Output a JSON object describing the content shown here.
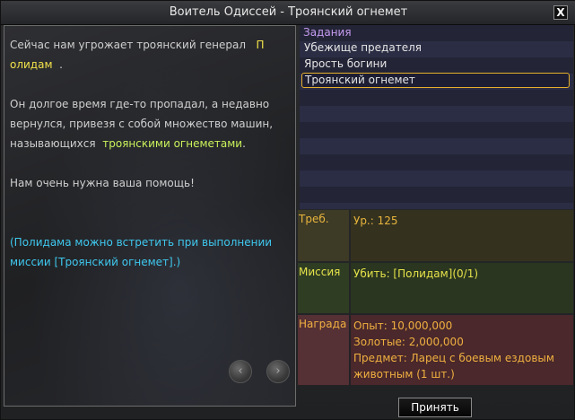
{
  "window": {
    "title": "Воитель Одиссей - Троянский огнемет",
    "close_label": "X"
  },
  "dialog": {
    "p1_text": "Сейчас нам угрожает троянский генерал",
    "p1_npc_a": "П",
    "p1_npc_b": "олидам",
    "p1_end": ".",
    "p2_a": "Он долгое время где-то пропадал, а недавно",
    "p2_b": "вернулся, привезя с собой множество машин,",
    "p2_c": "называющихся",
    "p2_highlight": "троянскими огнеметами",
    "p2_end": ".",
    "p3": "Нам очень нужна ваша помощь!",
    "hint_a": "(Полидама можно встретить при выполнении",
    "hint_b": "миссии [Троянский огнемет].)",
    "prev_glyph": "‹",
    "next_glyph": "›"
  },
  "quests": {
    "header": "Задания",
    "items": [
      {
        "label": "Убежище предателя"
      },
      {
        "label": "Ярость богини"
      },
      {
        "label": "Троянский огнемет"
      }
    ],
    "selected_index": 2
  },
  "info": {
    "req_label": "Треб.",
    "req_value": "Ур.: 125",
    "mission_label": "Миссия",
    "mission_value": "Убить: [Полидам](0/1)",
    "reward_label": "Награда",
    "reward_exp": "Опыт: 10,000,000",
    "reward_gold": "Золотые: 2,000,000",
    "reward_item_a": "Предмет: Ларец с боевым ездовым",
    "reward_item_b": "животным (1 шт.)"
  },
  "actions": {
    "accept_label": "Принять"
  },
  "colors": {
    "npc_name": "#f2e24a",
    "highlight": "#c9f25a",
    "hint": "#3fc8ee",
    "selected_border": "#e6b02c"
  }
}
